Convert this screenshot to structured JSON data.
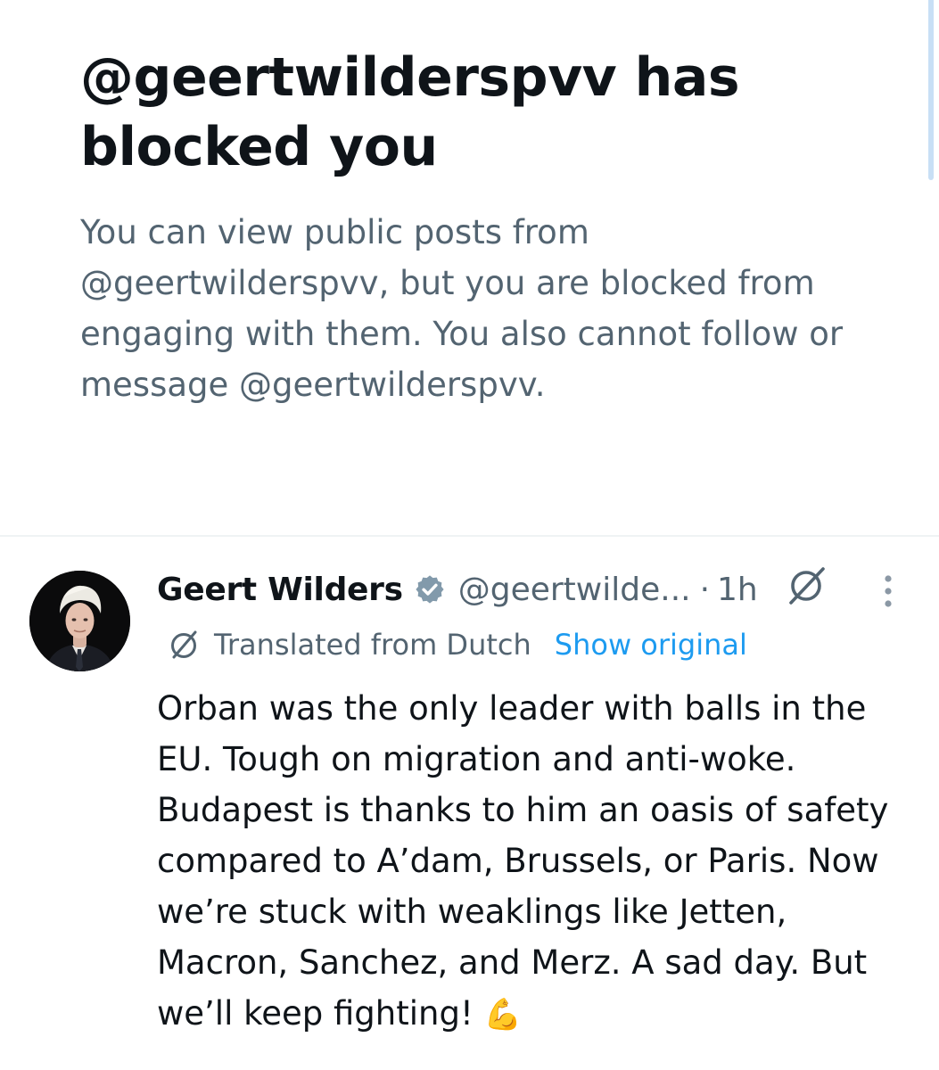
{
  "block_notice": {
    "title": "@geertwilderspvv has blocked you",
    "description": "You can view public posts from @geertwilderspvv, but you are blocked from engaging with them. You also cannot follow or message @geertwilderspvv."
  },
  "post": {
    "author_name": "Geert Wilders",
    "verified": true,
    "handle": "@geertwilde...",
    "separator": "·",
    "time": "1h",
    "translated_label": "Translated from Dutch",
    "show_original_label": "Show original",
    "text": "Orban was the only leader with balls in the EU. Tough on migration and anti-woke. Budapest is thanks to him an oasis of safety compared to A’dam, Brussels, or Paris. Now we’re stuck with weaklings like Jetten, Macron, Sanchez, and Merz. A sad day. But we’ll keep fighting! ",
    "emoji": "💪"
  },
  "icons": {
    "verified": "verified-badge-icon",
    "grok": "grok-icon",
    "more": "more-vertical-icon",
    "translate": "translate-icon"
  },
  "colors": {
    "text_primary": "#0f1419",
    "text_secondary": "#536471",
    "accent": "#1d9bf0",
    "divider": "#eff3f4"
  }
}
